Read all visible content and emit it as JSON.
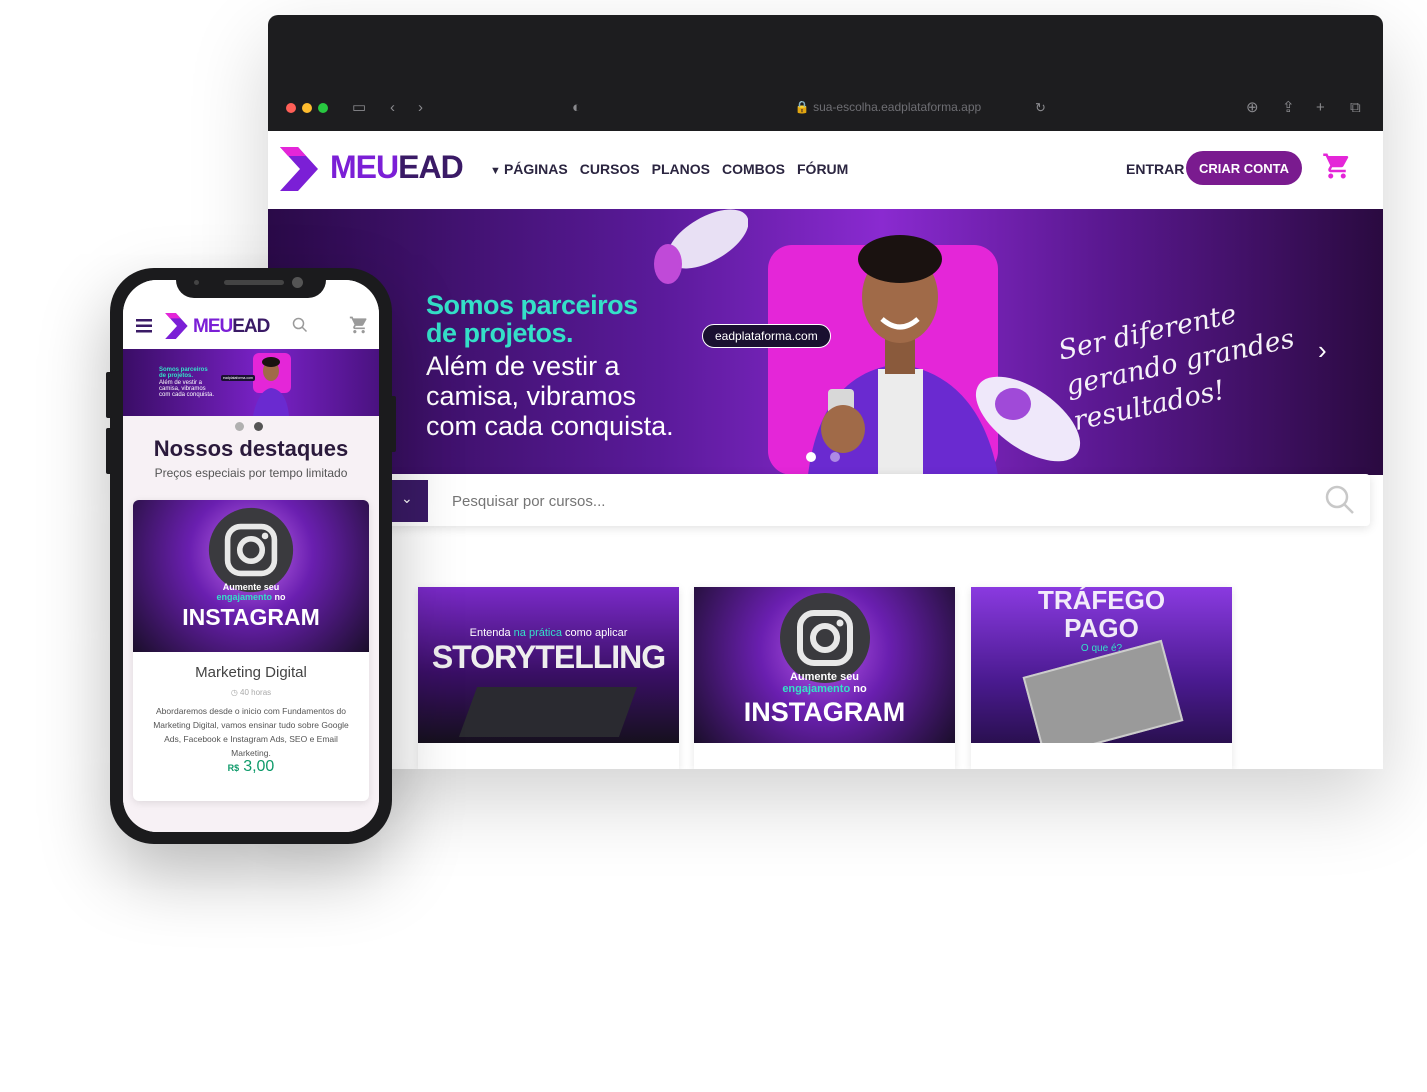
{
  "browser": {
    "url": "sua-escolha.eadplataforma.app",
    "controls": [
      "sidebar-icon",
      "back-icon",
      "forward-icon",
      "shield-icon",
      "reload-icon",
      "download-icon",
      "share-icon",
      "new-tab-icon",
      "tabs-icon"
    ]
  },
  "site": {
    "logo_part1": "MEU",
    "logo_part2": "EAD",
    "nav": [
      "PÁGINAS",
      "CURSOS",
      "PLANOS",
      "COMBOS",
      "FÓRUM"
    ],
    "entrar": "ENTRAR",
    "criar_conta": "CRIAR CONTA",
    "colors": {
      "brand_purple": "#7a1b8f",
      "accent_magenta": "#e426d8",
      "accent_teal": "#34e0c8"
    }
  },
  "hero": {
    "title_line1": "Somos parceiros",
    "title_line2": "de projetos.",
    "sub_line1": "Além de vestir a",
    "sub_line2": "camisa, vibramos",
    "sub_line3": "com cada conquista.",
    "pill": "eadplataforma.com",
    "script_line1": "Ser diferente",
    "script_line2": "gerando grandes",
    "script_line3": "resultados!",
    "slide_count": 2,
    "active_slide": 1
  },
  "search": {
    "placeholder": "Pesquisar por cursos..."
  },
  "courses": [
    {
      "line1_pre": "Entenda ",
      "line1_highlight": "na prática",
      "line1_post": " como aplicar",
      "title": "STORYTELLING"
    },
    {
      "line1": "Aumente seu",
      "line2_highlight": "engajamento",
      "line2_post": " no",
      "title": "INSTAGRAM"
    },
    {
      "title_line1": "TRÁFEGO",
      "title_line2": "PAGO",
      "sub": "O que é?"
    }
  ],
  "mobile": {
    "logo_part1": "MEU",
    "logo_part2": "EAD",
    "hero_title_line1": "Somos parceiros",
    "hero_title_line2": "de projetos.",
    "hero_sub_line1": "Além de vestir a",
    "hero_sub_line2": "camisa, vibramos",
    "hero_sub_line3": "com cada conquista.",
    "hero_pill": "eadplataforma.com",
    "section_title": "Nossos destaques",
    "section_sub": "Preços especiais por tempo limitado",
    "card": {
      "img_line1": "Aumente seu",
      "img_line2_highlight": "engajamento",
      "img_line2_post": " no",
      "img_title": "INSTAGRAM",
      "title": "Marketing Digital",
      "hours": "40 horas",
      "description": "Abordaremos desde o inicio com Fundamentos do Marketing Digital, vamos ensinar tudo sobre Google Ads, Facebook e Instagram Ads, SEO e Email Marketing.",
      "currency": "R$",
      "price": "3,00"
    }
  }
}
